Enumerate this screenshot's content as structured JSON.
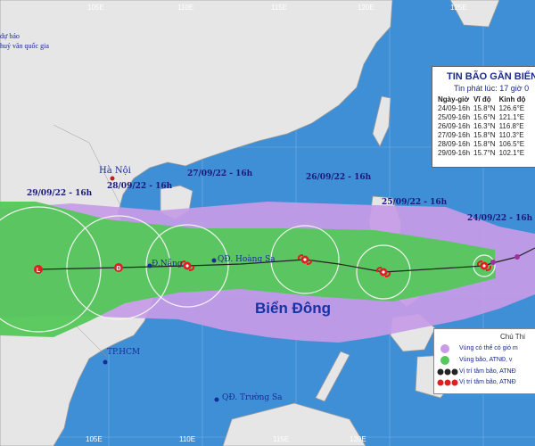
{
  "map": {
    "agency_lines": [
      "dự báo",
      "huỷ văn quốc gia"
    ],
    "longitude_ticks_top": [
      "105E",
      "110E",
      "115E",
      "120E",
      "125E"
    ],
    "longitude_ticks_bottom": [
      "105E",
      "110E",
      "115E",
      "120E"
    ],
    "cities": {
      "hanoi": "Hà Nội",
      "danang": "Đ.Nẵng",
      "hcm": "TP.HCM"
    },
    "islands": {
      "hoangsa": "QĐ. Hoàng Sa",
      "truongsa": "QĐ. Trường Sa"
    },
    "sea_name": "Biển Đông",
    "forecast_dates": [
      "29/09/22 - 16h",
      "28/09/22 - 16h",
      "27/09/22 - 16h",
      "26/09/22 - 16h",
      "25/09/22 - 16h",
      "24/09/22 - 16h"
    ]
  },
  "bulletin": {
    "title": "TIN BÃO GẦN BIỂN Đ",
    "issued": "Tin phát lúc: 17 giờ 0",
    "headers": [
      "Ngày-giờ",
      "Vĩ độ",
      "Kinh độ"
    ],
    "rows": [
      [
        "24/09-16h",
        "15.8°N",
        "126.6°E"
      ],
      [
        "25/09-16h",
        "15.6°N",
        "121.1°E"
      ],
      [
        "26/09-16h",
        "16.3°N",
        "116.8°E"
      ],
      [
        "27/09-16h",
        "15.8°N",
        "110.3°E"
      ],
      [
        "28/09-16h",
        "15.8°N",
        "106.5°E"
      ],
      [
        "29/09-16h",
        "15.7°N",
        "102.1°E"
      ]
    ]
  },
  "legend": {
    "title": "Chú Thi",
    "items": [
      "Vùng có thể có gió m",
      "Vùng bão, ATNĐ, v",
      "Vị trí tâm bão, ATNĐ",
      "Vị trí tâm bão, ATNĐ"
    ]
  },
  "colors": {
    "sea": "#3f8fd6",
    "land": "#e6e6e6",
    "risk_zone": "#c79be6",
    "storm_zone": "#55c85a",
    "storm_icon": "#e02020"
  }
}
